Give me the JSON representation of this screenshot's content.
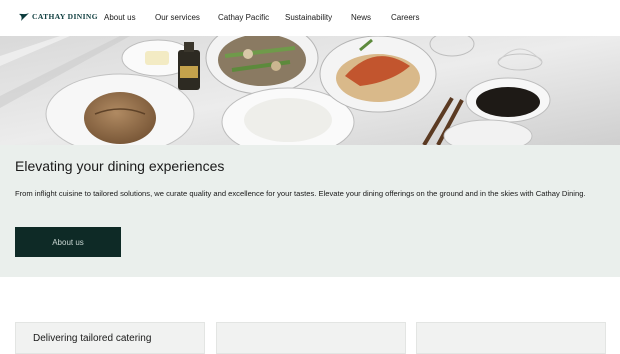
{
  "brand": {
    "name": "CATHAY DINING"
  },
  "nav": {
    "items": [
      {
        "label": "About us"
      },
      {
        "label": "Our services"
      },
      {
        "label": "Cathay Pacific"
      },
      {
        "label": "Sustainability"
      },
      {
        "label": "News"
      },
      {
        "label": "Careers"
      }
    ]
  },
  "hero": {
    "headline": "Elevating your dining experiences",
    "description": "From inflight cuisine to tailored solutions, we curate quality and excellence for your tastes. Elevate your dining offerings on the ground and in the skies with Cathay Dining.",
    "cta_label": "About us"
  },
  "cards": [
    {
      "title": "Delivering tailored catering"
    },
    {
      "title": ""
    },
    {
      "title": ""
    }
  ],
  "colors": {
    "brand_green": "#0b3b3c",
    "cta_background": "#0e2a26",
    "band_background": "#eaefec"
  }
}
